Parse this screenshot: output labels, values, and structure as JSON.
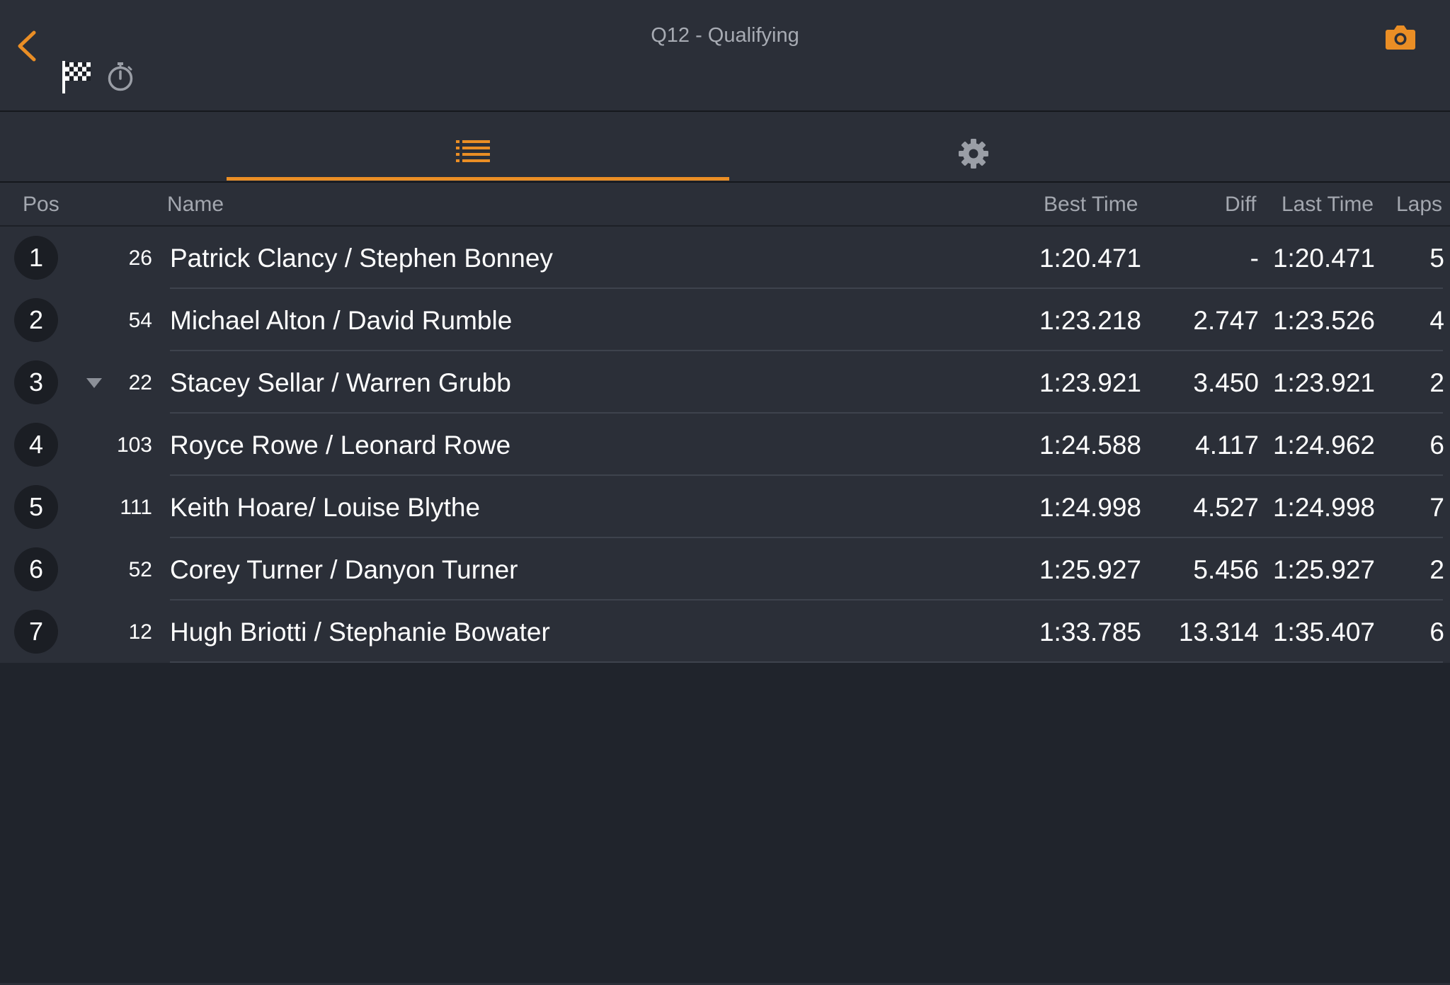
{
  "header": {
    "title": "Q12 - Qualifying",
    "accent_color": "#ea8e25"
  },
  "icons": {
    "back": "chevron-left-icon",
    "flag": "checkered-flag-icon",
    "stopwatch": "stopwatch-icon",
    "camera": "camera-icon",
    "list_tab": "list-icon",
    "settings_tab": "gear-icon"
  },
  "tabs": [
    {
      "name": "list",
      "active": true
    },
    {
      "name": "settings",
      "active": false
    }
  ],
  "columns": {
    "pos": "Pos",
    "name": "Name",
    "best": "Best Time",
    "diff": "Diff",
    "last": "Last Time",
    "laps": "Laps"
  },
  "rows": [
    {
      "pos": "1",
      "num": "26",
      "name": "Patrick Clancy /  Stephen Bonney",
      "best": "1:20.471",
      "diff": "-",
      "last": "1:20.471",
      "laps": "5",
      "trend": ""
    },
    {
      "pos": "2",
      "num": "54",
      "name": "Michael Alton /  David Rumble",
      "best": "1:23.218",
      "diff": "2.747",
      "last": "1:23.526",
      "laps": "4",
      "trend": ""
    },
    {
      "pos": "3",
      "num": "22",
      "name": "Stacey Sellar /  Warren Grubb",
      "best": "1:23.921",
      "diff": "3.450",
      "last": "1:23.921",
      "laps": "2",
      "trend": "down"
    },
    {
      "pos": "4",
      "num": "103",
      "name": "Royce Rowe /  Leonard Rowe",
      "best": "1:24.588",
      "diff": "4.117",
      "last": "1:24.962",
      "laps": "6",
      "trend": ""
    },
    {
      "pos": "5",
      "num": "111",
      "name": "Keith Hoare/ Louise Blythe",
      "best": "1:24.998",
      "diff": "4.527",
      "last": "1:24.998",
      "laps": "7",
      "trend": ""
    },
    {
      "pos": "6",
      "num": "52",
      "name": "Corey Turner /  Danyon Turner",
      "best": "1:25.927",
      "diff": "5.456",
      "last": "1:25.927",
      "laps": "2",
      "trend": ""
    },
    {
      "pos": "7",
      "num": "12",
      "name": "Hugh Briotti /  Stephanie Bowater",
      "best": "1:33.785",
      "diff": "13.314",
      "last": "1:35.407",
      "laps": "6",
      "trend": ""
    }
  ]
}
